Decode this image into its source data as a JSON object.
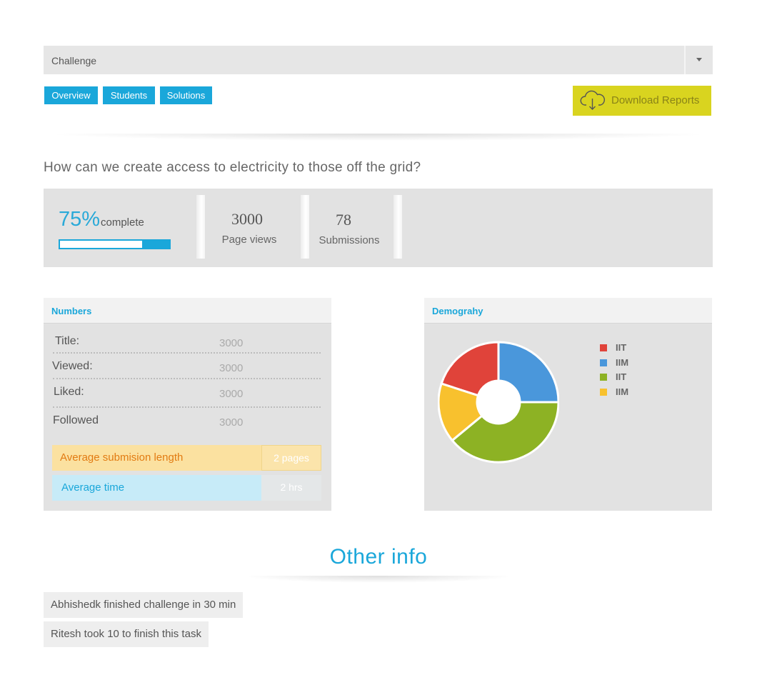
{
  "select": {
    "value": "Challenge"
  },
  "tabs": [
    "Overview",
    "Students",
    "Solutions"
  ],
  "download": {
    "label": "Download Reports",
    "icon": "cloud-download-icon"
  },
  "question": "How can we create access to electricity to those off the grid?",
  "stats": {
    "percent": "75%",
    "percent_label": "complete",
    "progress": 0.75,
    "page_views": "3000",
    "page_views_label": "Page views",
    "submissions": "78",
    "submissions_label": "Submissions"
  },
  "numbers": {
    "title": "Numbers",
    "rows": [
      {
        "label": "Title:",
        "value": "3000"
      },
      {
        "label": "Viewed:",
        "value": "3000"
      },
      {
        "label": "Liked:",
        "value": "3000"
      },
      {
        "label": "Followed",
        "value": "3000"
      }
    ],
    "avg_length": {
      "label": "Average submision length",
      "value": "2 pages"
    },
    "avg_time": {
      "label": "Average time",
      "value": "2 hrs"
    }
  },
  "demography": {
    "title": "Demograhy",
    "legend": [
      {
        "label": "IIT",
        "color": "#e0433a"
      },
      {
        "label": "IIM",
        "color": "#4a97db"
      },
      {
        "label": "IIT",
        "color": "#8db224"
      },
      {
        "label": "IIM",
        "color": "#f8c12e"
      }
    ]
  },
  "chart_data": {
    "type": "pie",
    "donut": true,
    "categories": [
      "IIT",
      "IIM",
      "IIT",
      "IIM"
    ],
    "values": [
      20,
      25,
      39,
      16
    ],
    "colors": [
      "#e0433a",
      "#4a97db",
      "#8db224",
      "#f8c12e"
    ]
  },
  "other_info": {
    "title": "Other info",
    "items": [
      "Abhishedk finished challenge in 30 min",
      "Ritesh took 10 to finish this task"
    ]
  }
}
